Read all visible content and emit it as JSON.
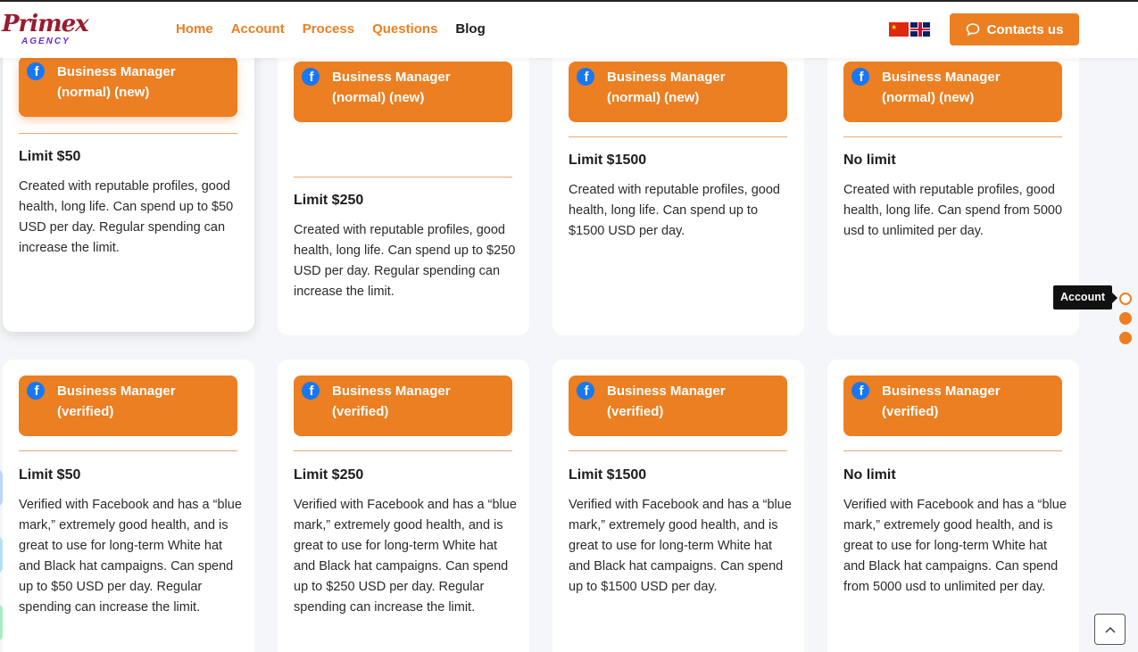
{
  "brand": {
    "logo_text": "Primex",
    "logo_sub": "AGENCY"
  },
  "nav": [
    {
      "label": "Home"
    },
    {
      "label": "Account"
    },
    {
      "label": "Process"
    },
    {
      "label": "Questions"
    },
    {
      "label": "Blog"
    }
  ],
  "header": {
    "contact_label": "Contacts us"
  },
  "colors": {
    "accent": "#ec7f22",
    "facebook": "#1877f2"
  },
  "cards": [
    {
      "title": "Business Manager (normal) (new)",
      "limit": "Limit $50",
      "desc": "Created with reputable profiles, good health, long life. Can spend up to $50 USD per day. Regular spending can increase the limit."
    },
    {
      "title": "Business Manager (normal) (new)",
      "limit": "Limit $250",
      "desc": "Created with reputable profiles, good health, long life. Can spend up to $250 USD per day. Regular spending can increase the limit."
    },
    {
      "title": "Business Manager (normal) (new)",
      "limit": "Limit $1500",
      "desc": "Created with reputable profiles, good health, long life. Can spend up to $1500 USD per day."
    },
    {
      "title": "Business Manager (normal) (new)",
      "limit": "No limit",
      "desc": "Created with reputable profiles, good health, long life. Can spend from 5000 usd to unlimited per day."
    },
    {
      "title": "Business Manager (verified)",
      "limit": "Limit $50",
      "desc": "Verified with Facebook and has a “blue mark,” extremely good health, and is great to use for long-term White hat and Black hat campaigns. Can spend up to $50 USD per day. Regular spending can increase the limit."
    },
    {
      "title": "Business Manager (verified)",
      "limit": "Limit $250",
      "desc": "Verified with Facebook and has a “blue mark,” extremely good health, and is great to use for long-term White hat and Black hat campaigns. Can spend up to $250 USD per day. Regular spending can increase the limit."
    },
    {
      "title": "Business Manager (verified)",
      "limit": "Limit $1500",
      "desc": "Verified with Facebook and has a “blue mark,” extremely good health, and is great to use for long-term White hat and Black hat campaigns. Can spend up to $1500 USD per day."
    },
    {
      "title": "Business Manager (verified)",
      "limit": "No limit",
      "desc": "Verified with Facebook and has a “blue mark,” extremely good health, and is great to use for long-term White hat and Black hat campaigns. Can spend from 5000 usd to unlimited per day."
    }
  ],
  "side_nav": {
    "tooltip": "Account",
    "dots": 3,
    "active_index": 0
  },
  "icons": {
    "fb": "facebook-icon",
    "chat": "chat-bubble-icon",
    "up": "chevron-up-icon"
  }
}
